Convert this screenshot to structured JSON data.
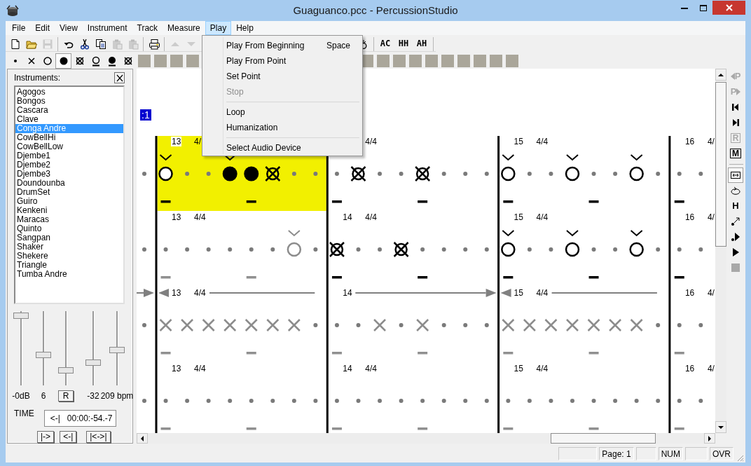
{
  "window": {
    "title": "Guaguanco.pcc - PercussionStudio"
  },
  "menu_bar": [
    {
      "label": "File",
      "selected": false
    },
    {
      "label": "Edit",
      "selected": false
    },
    {
      "label": "View",
      "selected": false
    },
    {
      "label": "Instrument",
      "selected": false
    },
    {
      "label": "Track",
      "selected": false
    },
    {
      "label": "Measure",
      "selected": false
    },
    {
      "label": "Play",
      "selected": true
    },
    {
      "label": "Help",
      "selected": false
    }
  ],
  "play_menu": [
    {
      "kind": "item",
      "label": "Play From Beginning",
      "shortcut": "Space",
      "disabled": false
    },
    {
      "kind": "item",
      "label": "Play From Point",
      "disabled": false
    },
    {
      "kind": "item",
      "label": "Set Point",
      "disabled": false
    },
    {
      "kind": "item",
      "label": "Stop",
      "disabled": true
    },
    {
      "kind": "separator"
    },
    {
      "kind": "item",
      "label": "Loop",
      "disabled": false
    },
    {
      "kind": "item",
      "label": "Humanization",
      "disabled": false
    },
    {
      "kind": "separator"
    },
    {
      "kind": "item",
      "label": "Select Audio Device",
      "disabled": false
    }
  ],
  "toolbar": {
    "left_groups": [
      [
        {
          "kind": "new",
          "disabled": false
        },
        {
          "kind": "open",
          "disabled": false
        },
        {
          "kind": "save",
          "disabled": true
        }
      ],
      [
        {
          "kind": "undo",
          "disabled": false
        },
        {
          "kind": "cut",
          "disabled": false
        },
        {
          "kind": "copy",
          "disabled": false
        },
        {
          "kind": "paste",
          "disabled": true
        },
        {
          "kind": "paste",
          "disabled": true
        }
      ],
      [
        {
          "kind": "print",
          "disabled": false
        }
      ],
      [
        {
          "kind": "up",
          "disabled": true
        },
        {
          "kind": "down",
          "disabled": true
        }
      ]
    ],
    "right_groups": [
      [
        {
          "kind": "bell",
          "disabled": false
        }
      ],
      [
        {
          "kind": "text",
          "label": "AC",
          "disabled": false
        },
        {
          "kind": "text",
          "label": "HH",
          "disabled": false
        },
        {
          "kind": "text",
          "label": "AH",
          "disabled": false
        }
      ]
    ]
  },
  "note_bar": {
    "left": [
      {
        "kind": "dot",
        "pressed": false
      },
      {
        "kind": "x",
        "pressed": false
      },
      {
        "kind": "open",
        "pressed": false
      },
      {
        "kind": "closed",
        "pressed": true
      },
      {
        "kind": "muted",
        "pressed": false
      },
      {
        "kind": "open-bar",
        "pressed": false
      },
      {
        "kind": "closed-bar",
        "pressed": false
      },
      {
        "kind": "muted",
        "pressed": false
      },
      {
        "kind": "blank",
        "pressed": false
      },
      {
        "kind": "blank",
        "pressed": false
      },
      {
        "kind": "blank",
        "pressed": false
      },
      {
        "kind": "blank",
        "pressed": false
      }
    ],
    "right": [
      {
        "kind": "blank",
        "pressed": false
      },
      {
        "kind": "blank",
        "pressed": false
      },
      {
        "kind": "blank",
        "pressed": false
      },
      {
        "kind": "blank",
        "pressed": false
      },
      {
        "kind": "blank",
        "pressed": false
      },
      {
        "kind": "blank",
        "pressed": false
      },
      {
        "kind": "blank",
        "pressed": false
      },
      {
        "kind": "blank",
        "pressed": false
      },
      {
        "kind": "blank",
        "pressed": false
      },
      {
        "kind": "blank",
        "pressed": false
      }
    ]
  },
  "instruments": {
    "title": "Instruments:",
    "items": [
      {
        "label": "Agogos",
        "selected": false
      },
      {
        "label": "Bongos",
        "selected": false
      },
      {
        "label": "Cascara",
        "selected": false
      },
      {
        "label": "Clave",
        "selected": false
      },
      {
        "label": "Conga Andre",
        "selected": true
      },
      {
        "label": "CowBellHi",
        "selected": false
      },
      {
        "label": "CowBellLow",
        "selected": false
      },
      {
        "label": "Djembe1",
        "selected": false
      },
      {
        "label": "Djembe2",
        "selected": false
      },
      {
        "label": "Djembe3",
        "selected": false
      },
      {
        "label": "Doundounba",
        "selected": false
      },
      {
        "label": "DrumSet",
        "selected": false
      },
      {
        "label": "Guiro",
        "selected": false
      },
      {
        "label": "Kenkeni",
        "selected": false
      },
      {
        "label": "Maracas",
        "selected": false
      },
      {
        "label": "Quinto",
        "selected": false
      },
      {
        "label": "Sangpan",
        "selected": false
      },
      {
        "label": "Shaker",
        "selected": false
      },
      {
        "label": "Shekere",
        "selected": false
      },
      {
        "label": "Triangle",
        "selected": false
      },
      {
        "label": "Tumba Andre",
        "selected": false
      }
    ]
  },
  "mixer": {
    "sliders": [
      {
        "level": 1.0,
        "reading": "-0dB"
      },
      {
        "level": 0.42,
        "reading": "6"
      },
      {
        "level": 0.2,
        "button": "R"
      },
      {
        "level": 0.31,
        "reading": "-32"
      },
      {
        "level": 0.5,
        "reading": "209 bpm"
      }
    ],
    "time_label": "TIME",
    "time_value": "<-|   00:00:-54.-7",
    "buttons": [
      "|->",
      "<-|",
      "|<->|"
    ]
  },
  "score": {
    "marker": ":1",
    "rows": [
      {
        "measures": [
          {
            "number": "13",
            "meter": "4/",
            "selected": true
          },
          {
            "meter": "4/4",
            "selected": false
          },
          {
            "number": "15",
            "meter": "4/4",
            "selected": false
          },
          {
            "number": "16",
            "meter": "4/",
            "selected": false
          }
        ],
        "notes": [
          {
            "kind": "dot",
            "accent": false,
            "dim": false
          },
          {
            "kind": "open",
            "accent": true,
            "dim": false
          },
          {
            "kind": "dot",
            "accent": false,
            "dim": false
          },
          {
            "kind": "dot",
            "accent": false,
            "dim": false
          },
          {
            "kind": "closed",
            "accent": true,
            "dim": false
          },
          {
            "kind": "closed",
            "accent": false,
            "dim": false
          },
          {
            "kind": "muted",
            "accent": false,
            "dim": false
          },
          {
            "kind": "dot",
            "accent": false,
            "dim": false
          },
          {
            "kind": "dot",
            "accent": false,
            "dim": false
          },
          {
            "kind": "dot",
            "accent": false,
            "dim": false
          },
          {
            "kind": "muted",
            "accent": false,
            "dim": false
          },
          {
            "kind": "dot",
            "accent": false,
            "dim": false
          },
          {
            "kind": "dot",
            "accent": false,
            "dim": false
          },
          {
            "kind": "muted",
            "accent": false,
            "dim": false
          },
          {
            "kind": "dot",
            "accent": false,
            "dim": false
          },
          {
            "kind": "dot",
            "accent": false,
            "dim": false
          },
          {
            "kind": "dot",
            "accent": false,
            "dim": false
          },
          {
            "kind": "open",
            "accent": true,
            "dim": false
          },
          {
            "kind": "dot",
            "accent": false,
            "dim": false
          },
          {
            "kind": "dot",
            "accent": false,
            "dim": false
          },
          {
            "kind": "open",
            "accent": true,
            "dim": false
          },
          {
            "kind": "dot",
            "accent": false,
            "dim": false
          },
          {
            "kind": "dot",
            "accent": false,
            "dim": false
          },
          {
            "kind": "open",
            "accent": true,
            "dim": false
          },
          {
            "kind": "dot",
            "accent": false,
            "dim": false
          },
          {
            "kind": "dot",
            "accent": false,
            "dim": false
          },
          {
            "kind": "dot",
            "accent": false,
            "dim": false
          }
        ]
      },
      {
        "measures": [
          {
            "number": "13",
            "meter": "4/4",
            "selected": false
          },
          {
            "number": "14",
            "meter": "4/4",
            "selected": false
          },
          {
            "number": "15",
            "meter": "4/4",
            "selected": false
          },
          {
            "number": "16",
            "meter": "4/",
            "selected": false
          }
        ],
        "notes": [
          {
            "kind": "dot",
            "accent": false,
            "dim": false
          },
          {
            "kind": "dot",
            "accent": false,
            "dim": false
          },
          {
            "kind": "dot",
            "accent": false,
            "dim": false
          },
          {
            "kind": "dot",
            "accent": false,
            "dim": false
          },
          {
            "kind": "dot",
            "accent": false,
            "dim": false
          },
          {
            "kind": "dot",
            "accent": false,
            "dim": false
          },
          {
            "kind": "dot",
            "accent": false,
            "dim": false
          },
          {
            "kind": "open",
            "accent": true,
            "dim": true
          },
          {
            "kind": "dot",
            "accent": false,
            "dim": false
          },
          {
            "kind": "muted",
            "accent": false,
            "dim": false
          },
          {
            "kind": "dot",
            "accent": false,
            "dim": false
          },
          {
            "kind": "dot",
            "accent": false,
            "dim": false
          },
          {
            "kind": "muted",
            "accent": false,
            "dim": false
          },
          {
            "kind": "dot",
            "accent": false,
            "dim": false
          },
          {
            "kind": "dot",
            "accent": false,
            "dim": false
          },
          {
            "kind": "dot",
            "accent": false,
            "dim": false
          },
          {
            "kind": "dot",
            "accent": false,
            "dim": false
          },
          {
            "kind": "open",
            "accent": true,
            "dim": false
          },
          {
            "kind": "dot",
            "accent": false,
            "dim": false
          },
          {
            "kind": "dot",
            "accent": false,
            "dim": false
          },
          {
            "kind": "open",
            "accent": true,
            "dim": false
          },
          {
            "kind": "dot",
            "accent": false,
            "dim": false
          },
          {
            "kind": "dot",
            "accent": false,
            "dim": false
          },
          {
            "kind": "open",
            "accent": true,
            "dim": false
          },
          {
            "kind": "dot",
            "accent": false,
            "dim": false
          },
          {
            "kind": "dot",
            "accent": false,
            "dim": false
          },
          {
            "kind": "dot",
            "accent": false,
            "dim": false
          }
        ]
      },
      {
        "loop": true,
        "measures": [
          {
            "number": "13",
            "meter": "4/4",
            "selected": false
          },
          {
            "number": "14",
            "selected": false
          },
          {
            "number": "15",
            "meter": "4/4",
            "selected": false
          },
          {
            "number": "16",
            "meter": "4/",
            "selected": false
          }
        ],
        "notes": [
          {
            "kind": "dot",
            "accent": false,
            "dim": false
          },
          {
            "kind": "x",
            "accent": false,
            "dim": true
          },
          {
            "kind": "x",
            "accent": false,
            "dim": true
          },
          {
            "kind": "x",
            "accent": false,
            "dim": true
          },
          {
            "kind": "x",
            "accent": false,
            "dim": true
          },
          {
            "kind": "x",
            "accent": false,
            "dim": true
          },
          {
            "kind": "x",
            "accent": false,
            "dim": true
          },
          {
            "kind": "x",
            "accent": false,
            "dim": true
          },
          {
            "kind": "dot",
            "accent": false,
            "dim": false
          },
          {
            "kind": "dot",
            "accent": false,
            "dim": false
          },
          {
            "kind": "dot",
            "accent": false,
            "dim": false
          },
          {
            "kind": "x",
            "accent": false,
            "dim": true
          },
          {
            "kind": "dot",
            "accent": false,
            "dim": false
          },
          {
            "kind": "x",
            "accent": false,
            "dim": true
          },
          {
            "kind": "dot",
            "accent": false,
            "dim": false
          },
          {
            "kind": "dot",
            "accent": false,
            "dim": false
          },
          {
            "kind": "dot",
            "accent": false,
            "dim": false
          },
          {
            "kind": "x",
            "accent": false,
            "dim": true
          },
          {
            "kind": "x",
            "accent": false,
            "dim": true
          },
          {
            "kind": "x",
            "accent": false,
            "dim": true
          },
          {
            "kind": "x",
            "accent": false,
            "dim": true
          },
          {
            "kind": "x",
            "accent": false,
            "dim": true
          },
          {
            "kind": "x",
            "accent": false,
            "dim": true
          },
          {
            "kind": "x",
            "accent": false,
            "dim": true
          },
          {
            "kind": "dot",
            "accent": false,
            "dim": false
          },
          {
            "kind": "dot",
            "accent": false,
            "dim": false
          },
          {
            "kind": "dot",
            "accent": false,
            "dim": false
          }
        ]
      },
      {
        "measures": [
          {
            "number": "13",
            "meter": "4/4",
            "selected": false
          },
          {
            "number": "14",
            "meter": "4/4",
            "selected": false
          },
          {
            "number": "15",
            "meter": "4/4",
            "selected": false
          },
          {
            "number": "16",
            "meter": "4/",
            "selected": false
          }
        ],
        "notes": [
          {
            "kind": "dot",
            "accent": false,
            "dim": false
          },
          {
            "kind": "dot",
            "accent": false,
            "dim": false
          },
          {
            "kind": "dot",
            "accent": false,
            "dim": false
          },
          {
            "kind": "dot",
            "accent": false,
            "dim": false
          },
          {
            "kind": "dot",
            "accent": false,
            "dim": false
          },
          {
            "kind": "dot",
            "accent": false,
            "dim": false
          },
          {
            "kind": "dot",
            "accent": false,
            "dim": false
          },
          {
            "kind": "dot",
            "accent": false,
            "dim": false
          },
          {
            "kind": "dot",
            "accent": false,
            "dim": false
          },
          {
            "kind": "dot",
            "accent": false,
            "dim": false
          },
          {
            "kind": "dot",
            "accent": false,
            "dim": false
          },
          {
            "kind": "dot",
            "accent": false,
            "dim": false
          },
          {
            "kind": "dot",
            "accent": false,
            "dim": false
          },
          {
            "kind": "dot",
            "accent": false,
            "dim": false
          },
          {
            "kind": "dot",
            "accent": false,
            "dim": false
          },
          {
            "kind": "dot",
            "accent": false,
            "dim": false
          },
          {
            "kind": "dot",
            "accent": false,
            "dim": false
          },
          {
            "kind": "dot",
            "accent": false,
            "dim": false
          },
          {
            "kind": "dot",
            "accent": false,
            "dim": false
          },
          {
            "kind": "dot",
            "accent": false,
            "dim": false
          },
          {
            "kind": "dot",
            "accent": false,
            "dim": false
          },
          {
            "kind": "dot",
            "accent": false,
            "dim": false
          },
          {
            "kind": "dot",
            "accent": false,
            "dim": false
          },
          {
            "kind": "dot",
            "accent": false,
            "dim": false
          },
          {
            "kind": "dot",
            "accent": false,
            "dim": false
          },
          {
            "kind": "dot",
            "accent": false,
            "dim": false
          },
          {
            "kind": "dot",
            "accent": false,
            "dim": false
          }
        ]
      }
    ]
  },
  "side_toolbar": [
    {
      "kind": "prev-point",
      "label": "P",
      "disabled": true,
      "pressed": false
    },
    {
      "kind": "next-point",
      "label": "P",
      "disabled": true,
      "pressed": false
    },
    {
      "kind": "to-start",
      "disabled": false,
      "pressed": false
    },
    {
      "kind": "to-end",
      "disabled": false,
      "pressed": false
    },
    {
      "kind": "boxed",
      "label": "R",
      "disabled": true,
      "pressed": false
    },
    {
      "kind": "boxed",
      "label": "M",
      "disabled": false,
      "pressed": false
    },
    {
      "kind": "separator"
    },
    {
      "kind": "fit",
      "disabled": false,
      "pressed": true
    },
    {
      "kind": "loop",
      "disabled": false,
      "pressed": false
    },
    {
      "kind": "letter",
      "label": "H",
      "disabled": false,
      "pressed": false
    },
    {
      "kind": "dot-arrow",
      "disabled": false,
      "pressed": false
    },
    {
      "kind": "dot-play",
      "disabled": false,
      "pressed": false
    },
    {
      "kind": "play",
      "disabled": false,
      "pressed": false
    },
    {
      "kind": "stop",
      "disabled": true,
      "pressed": false
    }
  ],
  "status_bar": [
    {
      "text": "Page: 1"
    },
    {
      "text": "NUM"
    },
    {
      "text": "OVR"
    }
  ]
}
